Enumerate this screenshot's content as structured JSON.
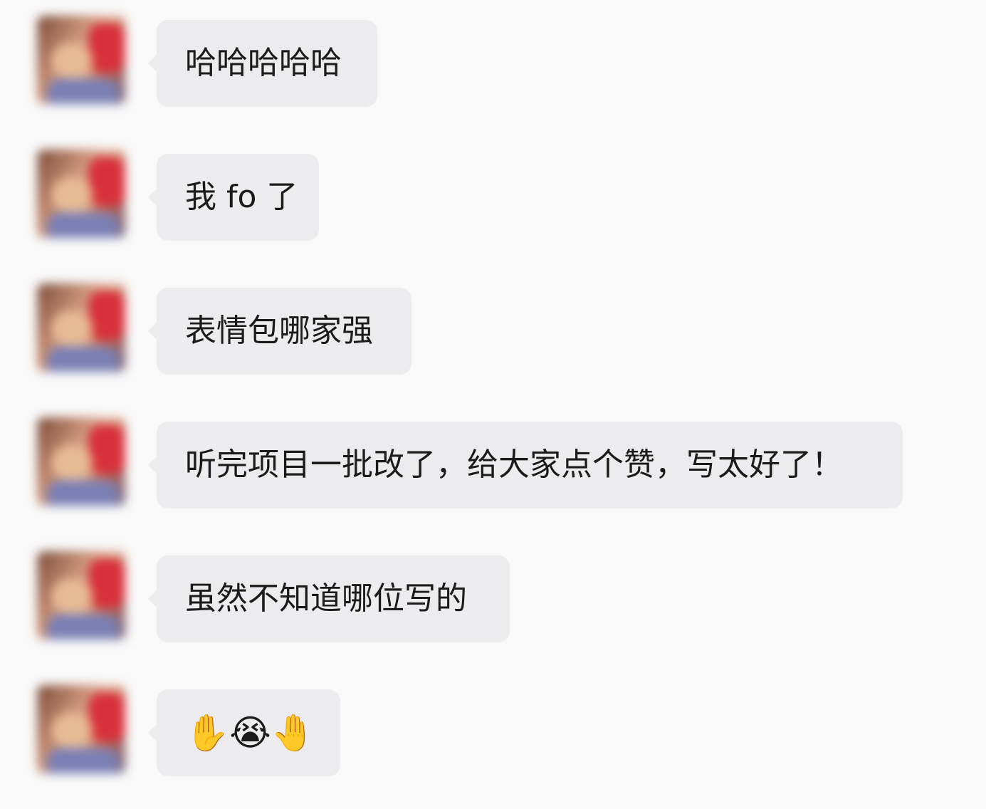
{
  "messages": [
    {
      "text": "哈哈哈哈哈"
    },
    {
      "text": "我 fo 了"
    },
    {
      "text": "表情包哪家强"
    },
    {
      "text": "听完项目一批改了，给大家点个赞，写太好了！"
    },
    {
      "text": "虽然不知道哪位写的"
    },
    {
      "emojis": [
        "✋",
        "😭",
        "🤚"
      ]
    }
  ]
}
